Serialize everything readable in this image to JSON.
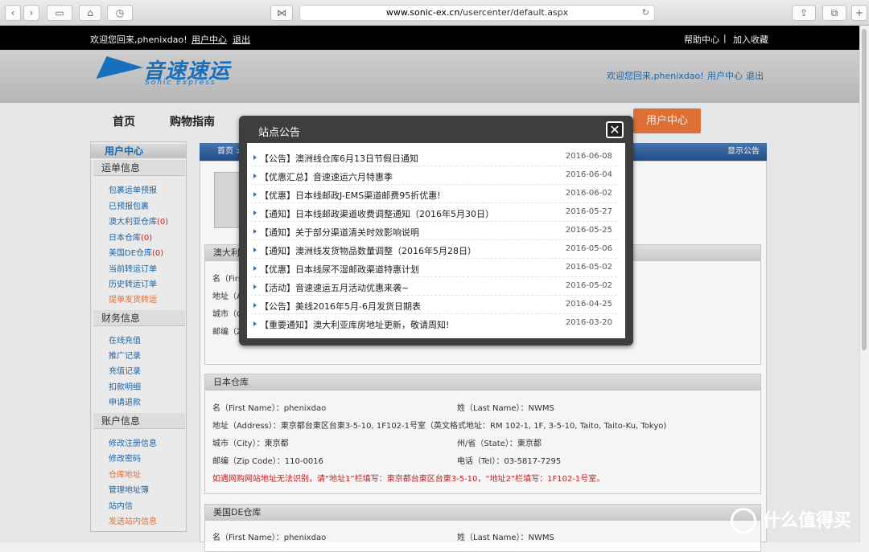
{
  "browser": {
    "url_domain": "www.sonic-ex.cn",
    "url_path": "/usercenter/default.aspx",
    "back_icon": "chevron-left-icon",
    "forward_icon": "chevron-right-icon"
  },
  "topbar": {
    "welcome": "欢迎您回来,phenixdao!",
    "user_center": "用户中心",
    "logout": "退出",
    "help": "帮助中心",
    "sep": "|",
    "favorite": "加入收藏"
  },
  "header": {
    "logo_cn": "音速速运",
    "logo_en": "Sonic Express",
    "welcome": "欢迎您回来,phenixdao!",
    "user_center": "用户中心",
    "logout": "退出"
  },
  "nav": {
    "home": "首页",
    "guide": "购物指南",
    "user_center": "用户中心"
  },
  "sidebar": {
    "title": "用户中心",
    "sec1": "运单信息",
    "sec1_items": [
      "包裹运单预报",
      "已预报包裹",
      "澳大利亚仓库",
      "日本仓库",
      "美国DE仓库",
      "当前转运订单",
      "历史转运订单",
      "提单发货转运"
    ],
    "counts": [
      "(0)",
      "(0)",
      "(0)"
    ],
    "sec2": "财务信息",
    "sec2_items": [
      "在线充值",
      "推广记录",
      "充值记录",
      "扣款明细",
      "申请退款"
    ],
    "sec3": "账户信息",
    "sec3_items": [
      "修改注册信息",
      "修改密码",
      "仓库地址",
      "管理地址簿",
      "站内信",
      "发送站内信息"
    ]
  },
  "crumb": {
    "home": "首页 >",
    "show_notice": "显示公告"
  },
  "au": {
    "head": "澳大利",
    "name": "名（Firs",
    "addr": "地址（A",
    "city": "城市（C",
    "zip": "邮编（Z"
  },
  "jp": {
    "head": "日本仓库",
    "first_name": "名（First Name）：phenixdao",
    "last_name": "姓（Last Name）：NWMS",
    "address": "地址（Address）：東京都台東区台東3-5-10, 1F102-1号室（英文格式地址：RM 102-1, 1F, 3-5-10, Taito, Taito-Ku, Tokyo)",
    "city": "城市（City）：東京都",
    "state": "州/省（State）：東京都",
    "zip": "邮编（Zip Code）：110-0016",
    "tel": "电话（Tel）：03-5817-7295",
    "note": "如遇网购网站地址无法识别，请“地址1”栏填写：東京都台東区台東3-5-10，“地址2”栏填写：1F102-1号室。"
  },
  "us": {
    "head": "美国DE仓库",
    "first_name": "名（First Name）：phenixdao",
    "last_name": "姓（Last Name）：NWMS"
  },
  "modal": {
    "title": "站点公告",
    "close_icon": "close-icon",
    "items": [
      {
        "title": "【公告】澳洲线仓库6月13日节假日通知",
        "date": "2016-06-08"
      },
      {
        "title": "【优惠汇总】音速速运六月特惠季",
        "date": "2016-06-04"
      },
      {
        "title": "【优惠】日本线邮政J-EMS渠道邮费95折优惠!",
        "date": "2016-06-02"
      },
      {
        "title": "【通知】日本线邮政渠道收费调整通知（2016年5月30日）",
        "date": "2016-05-27"
      },
      {
        "title": "【通知】关于部分渠道清关时效影响说明",
        "date": "2016-05-25"
      },
      {
        "title": "【通知】澳洲线发货物品数量调整（2016年5月28日）",
        "date": "2016-05-06"
      },
      {
        "title": "【优惠】日本线尿不湿邮政渠道特惠计划",
        "date": "2016-05-02"
      },
      {
        "title": "【活动】音速速运五月活动优惠来袭~",
        "date": "2016-05-02"
      },
      {
        "title": "【公告】美线2016年5月-6月发货日期表",
        "date": "2016-04-25"
      },
      {
        "title": "【重要通知】澳大利亚库房地址更新，敬请周知!",
        "date": "2016-03-20"
      }
    ]
  },
  "watermark": "什么值得买"
}
